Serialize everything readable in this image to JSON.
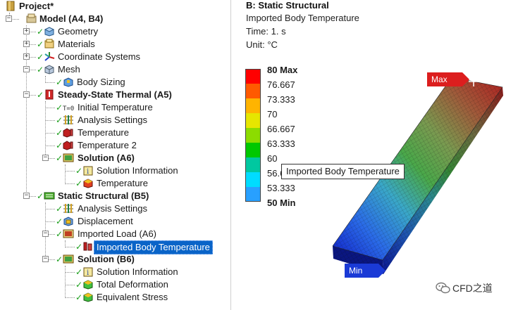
{
  "tree": {
    "nodes": [
      {
        "label": "Project*",
        "bold": true,
        "icon": "project-icon"
      },
      {
        "label": "Model (A4, B4)",
        "bold": true,
        "icon": "model-icon"
      },
      {
        "label": "Geometry",
        "icon": "geometry-icon"
      },
      {
        "label": "Materials",
        "icon": "materials-icon"
      },
      {
        "label": "Coordinate Systems",
        "icon": "coordinate-systems-icon"
      },
      {
        "label": "Mesh",
        "icon": "mesh-icon"
      },
      {
        "label": "Body Sizing",
        "icon": "body-sizing-icon"
      },
      {
        "label": "Steady-State Thermal (A5)",
        "bold": true,
        "icon": "thermal-icon"
      },
      {
        "label": "Initial Temperature",
        "icon": "initial-temperature-icon"
      },
      {
        "label": "Analysis Settings",
        "icon": "analysis-settings-icon"
      },
      {
        "label": "Temperature",
        "icon": "temperature-icon"
      },
      {
        "label": "Temperature 2",
        "icon": "temperature-icon"
      },
      {
        "label": "Solution (A6)",
        "bold": true,
        "icon": "solution-icon"
      },
      {
        "label": "Solution Information",
        "icon": "solution-information-icon"
      },
      {
        "label": "Temperature",
        "icon": "temperature-result-icon"
      },
      {
        "label": "Static Structural (B5)",
        "bold": true,
        "icon": "static-structural-icon"
      },
      {
        "label": "Analysis Settings",
        "icon": "analysis-settings-icon"
      },
      {
        "label": "Displacement",
        "icon": "displacement-icon"
      },
      {
        "label": "Imported Load (A6)",
        "icon": "imported-load-icon"
      },
      {
        "label": "Imported Body Temperature",
        "icon": "imported-body-temperature-icon",
        "selected": true
      },
      {
        "label": "Solution (B6)",
        "bold": true,
        "icon": "solution-icon"
      },
      {
        "label": "Solution Information",
        "icon": "solution-information-icon"
      },
      {
        "label": "Total Deformation",
        "icon": "total-deformation-icon"
      },
      {
        "label": "Equivalent Stress",
        "icon": "equivalent-stress-icon"
      }
    ]
  },
  "viewport": {
    "title": "B: Static Structural",
    "subtitle": "Imported Body Temperature",
    "time": "Time: 1. s",
    "unit": "Unit: °C",
    "probe_label": "Imported Body Temperature",
    "max_flag": "Max",
    "min_flag": "Min"
  },
  "legend": {
    "labels": [
      "80 Max",
      "76.667",
      "73.333",
      "70",
      "66.667",
      "63.333",
      "60",
      "56.667",
      "53.333",
      "50 Min"
    ],
    "colors": [
      "#ff0000",
      "#ff5a00",
      "#ffb400",
      "#e6e600",
      "#8cdc00",
      "#00c800",
      "#00c8a0",
      "#00dcff",
      "#28a0ff",
      "#0000ff"
    ]
  },
  "watermark": {
    "text": "CFD之道"
  }
}
